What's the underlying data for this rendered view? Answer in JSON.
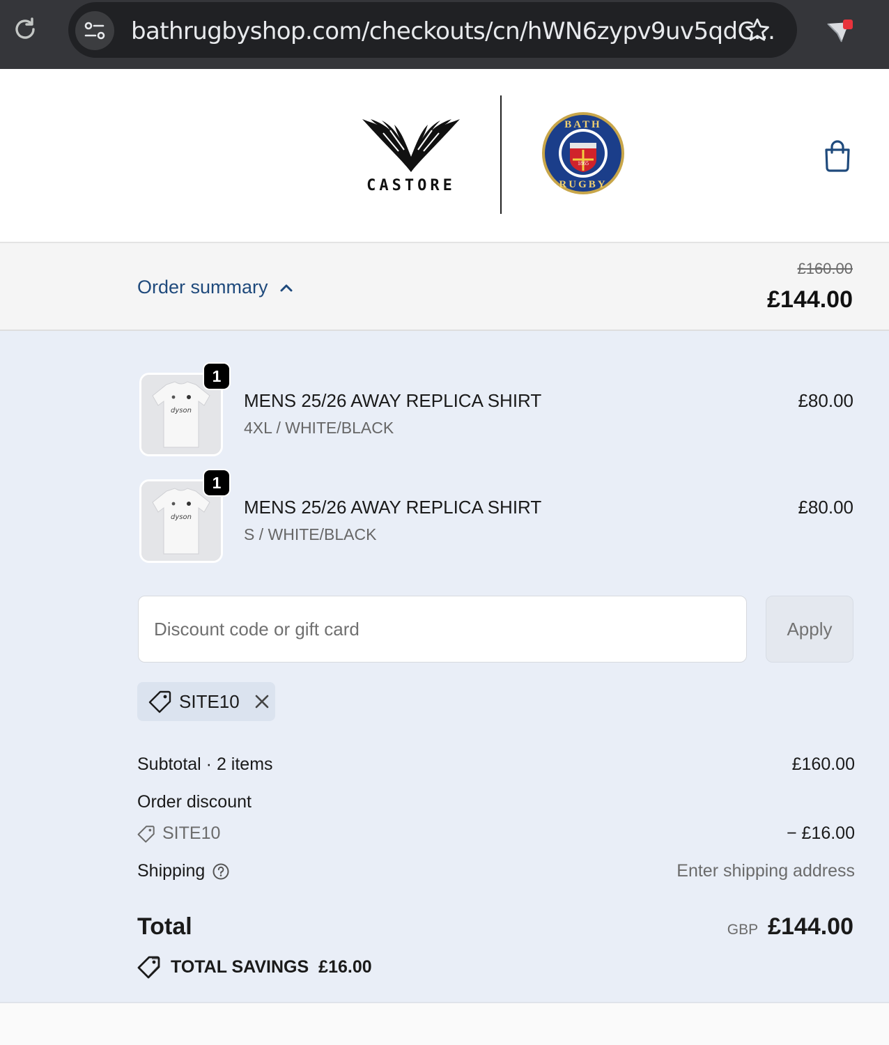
{
  "browser": {
    "url": "bathrugbyshop.com/checkouts/cn/hWN6zypv9uv5qdC..."
  },
  "header": {
    "brand_left": "CASTORE",
    "brand_right": "BATH RUGBY",
    "crest_year": "1865"
  },
  "summary_bar": {
    "toggle_label": "Order summary",
    "original_total": "£160.00",
    "total": "£144.00"
  },
  "items": [
    {
      "quantity": "1",
      "title": "MENS 25/26 AWAY REPLICA SHIRT",
      "variant": "4XL / WHITE/BLACK",
      "price": "£80.00",
      "shirt_print": "dyson"
    },
    {
      "quantity": "1",
      "title": "MENS 25/26 AWAY REPLICA SHIRT",
      "variant": "S / WHITE/BLACK",
      "price": "£80.00",
      "shirt_print": "dyson"
    }
  ],
  "discount": {
    "placeholder": "Discount code or gift card",
    "apply_label": "Apply",
    "applied_code": "SITE10"
  },
  "totals": {
    "subtotal_label": "Subtotal · 2 items",
    "subtotal_value": "£160.00",
    "order_discount_label": "Order discount",
    "discount_code": "SITE10",
    "discount_value": "− £16.00",
    "shipping_label": "Shipping",
    "shipping_value": "Enter shipping address",
    "total_label": "Total",
    "currency": "GBP",
    "total_value": "£144.00",
    "savings_label": "TOTAL SAVINGS",
    "savings_value": "£16.00"
  },
  "colors": {
    "browser_chrome": "#35363a",
    "omnibox": "#202124",
    "link": "#1f4a7c",
    "summary_background": "#e9eef7",
    "chip_background": "#dbe3ef"
  },
  "icons": [
    "reload-icon",
    "site-info-icon",
    "star-icon",
    "extension-icon",
    "shopping-bag-icon",
    "chevron-up-icon",
    "tag-icon",
    "close-icon",
    "help-icon"
  ]
}
